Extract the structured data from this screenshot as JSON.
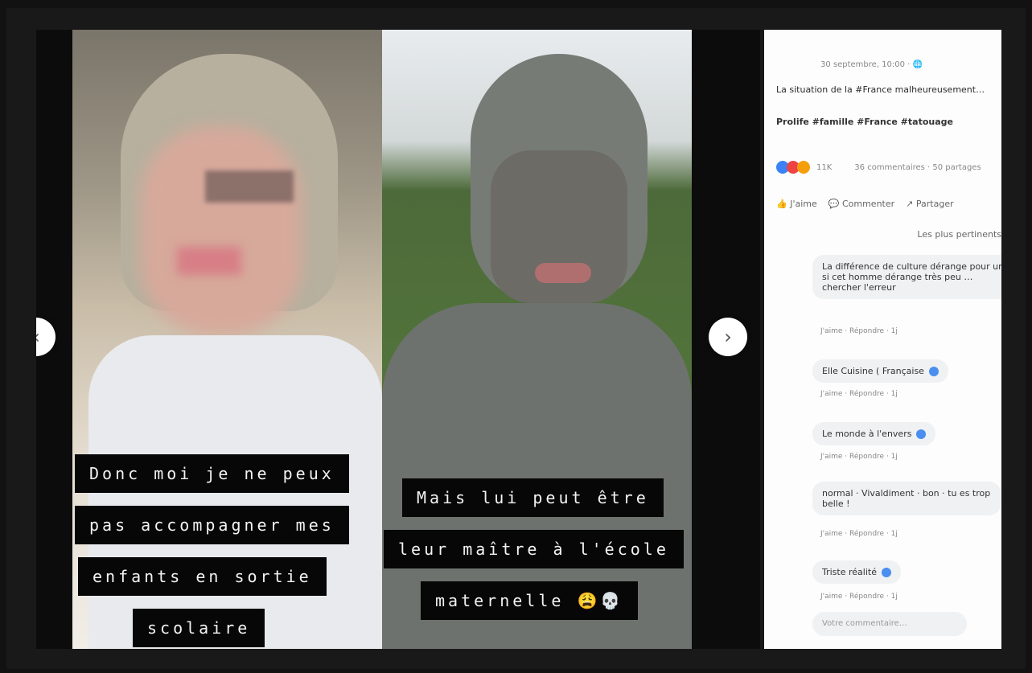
{
  "post": {
    "date": "30 septembre, 10:00 · 🌐",
    "text": "La situation de la #France malheureusement…",
    "hashtags": "Prolife #famille #France #tatouage",
    "reaction_count": "11K",
    "comment_count": "36 commentaires · 50 partages",
    "actions": [
      "J'aime",
      "Commenter",
      "Partager"
    ],
    "sort_label": "Les plus pertinents"
  },
  "captions": {
    "left": [
      "Donc moi je ne peux",
      "pas accompagner mes",
      "enfants en sortie",
      "scolaire"
    ],
    "right": [
      "Mais lui peut être",
      "leur maître à l'école",
      "maternelle 😩💀"
    ]
  },
  "comments": [
    {
      "text": "La différence de culture dérange pour un si cet homme dérange très peu … chercher l'erreur",
      "actions": "J'aime · Répondre · 1j"
    },
    {
      "text": "Elle Cuisine ( Française",
      "actions": "J'aime · Répondre · 1j"
    },
    {
      "text": "Le monde à l'envers",
      "actions": "J'aime · Répondre · 1j"
    },
    {
      "text": "normal · Vivaldiment · bon · tu es trop belle !",
      "actions": "J'aime · Répondre · 1j"
    },
    {
      "text": "Triste réalité",
      "actions": "J'aime · Répondre · 1j"
    }
  ],
  "comment_placeholder": "Votre commentaire…",
  "icons": {
    "expand": "expand-icon",
    "next": "chevron-right-icon",
    "prev": "chevron-left-icon"
  },
  "colors": {
    "reaction_like": "#3b82f6",
    "reaction_love": "#ef4444",
    "reaction_haha": "#f59e0b",
    "verified": "#4a8ef0"
  }
}
